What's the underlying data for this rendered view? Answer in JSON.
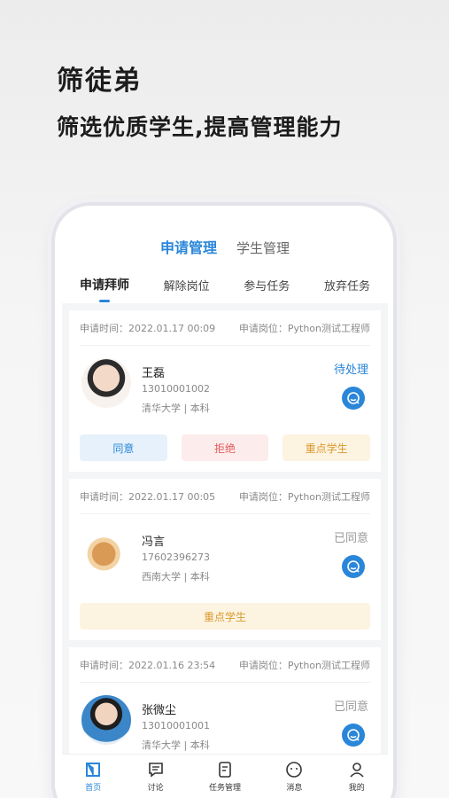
{
  "hero": {
    "title": "筛徒弟",
    "subtitle": "筛选优质学生,提高管理能力"
  },
  "top_tabs": [
    {
      "label": "申请管理",
      "active": true
    },
    {
      "label": "学生管理",
      "active": false
    }
  ],
  "sub_tabs": [
    {
      "label": "申请拜师",
      "active": true
    },
    {
      "label": "解除岗位",
      "active": false
    },
    {
      "label": "参与任务",
      "active": false
    },
    {
      "label": "放弃任务",
      "active": false
    }
  ],
  "cards": [
    {
      "apply_time": "申请时间：2022.01.17 00:09",
      "apply_post": "申请岗位：Python测试工程师",
      "name": "王磊",
      "phone": "13010001002",
      "school": "清华大学 | 本科",
      "status": "待处理",
      "actions": [
        "同意",
        "拒绝",
        "重点学生"
      ]
    },
    {
      "apply_time": "申请时间：2022.01.17 00:05",
      "apply_post": "申请岗位：Python测试工程师",
      "name": "冯言",
      "phone": "17602396273",
      "school": "西南大学 | 本科",
      "status": "已同意",
      "actions": [
        "重点学生"
      ]
    },
    {
      "apply_time": "申请时间：2022.01.16 23:54",
      "apply_post": "申请岗位：Python测试工程师",
      "name": "张微尘",
      "phone": "13010001001",
      "school": "清华大学 | 本科",
      "status": "已同意",
      "actions": []
    }
  ],
  "bottom_nav": [
    {
      "label": "首页",
      "icon": "home-icon",
      "active": true
    },
    {
      "label": "讨论",
      "icon": "discussion-icon",
      "active": false
    },
    {
      "label": "任务管理",
      "icon": "task-icon",
      "active": false
    },
    {
      "label": "消息",
      "icon": "message-icon",
      "active": false
    },
    {
      "label": "我的",
      "icon": "profile-icon",
      "active": false
    }
  ],
  "colors": {
    "accent": "#2a86d9",
    "reject": "#e35a5a",
    "key": "#d89a2e"
  }
}
